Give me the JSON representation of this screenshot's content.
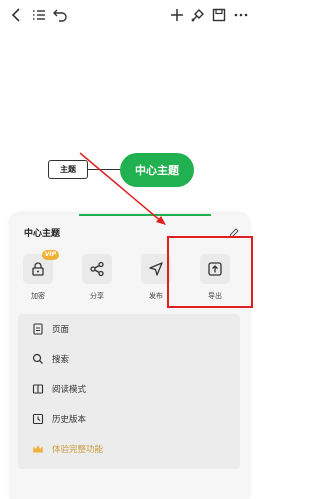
{
  "toolbar": {
    "icons": [
      "chevron-left-icon",
      "outline-list-icon",
      "undo-icon",
      "plus-icon",
      "brush-icon",
      "save-icon",
      "more-icon"
    ]
  },
  "canvas": {
    "central_node": "中心主题",
    "sub_node": "主题",
    "node_color": "#22b150"
  },
  "sheet": {
    "title": "中心主题",
    "actions": [
      {
        "label": "加密",
        "icon": "lock-icon",
        "badge": "VIP"
      },
      {
        "label": "分享",
        "icon": "share-icon"
      },
      {
        "label": "发布",
        "icon": "send-icon"
      },
      {
        "label": "导出",
        "icon": "export-icon"
      }
    ],
    "menu": [
      {
        "label": "页面",
        "icon": "page-icon"
      },
      {
        "label": "搜索",
        "icon": "search-icon"
      },
      {
        "label": "阅读模式",
        "icon": "book-icon"
      },
      {
        "label": "历史版本",
        "icon": "history-icon"
      },
      {
        "label": "体验完整功能",
        "icon": "crown-icon"
      }
    ]
  },
  "colors": {
    "annotation_red": "#e02020",
    "vip_gold": "#f2b036"
  }
}
